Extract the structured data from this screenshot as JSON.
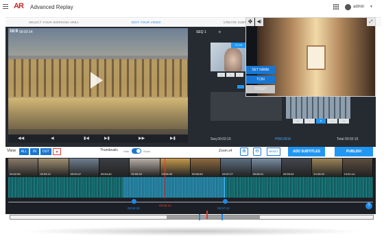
{
  "app": {
    "logo": "AR",
    "title": "Advanced Replay"
  },
  "user": {
    "name": "admin"
  },
  "steps": [
    {
      "label": "SELECT YOUR WORKING AREA",
      "active": false
    },
    {
      "label": "EDIT YOUR VIDEO",
      "active": true
    },
    {
      "label": "CREATE SUBTI...",
      "active": false
    }
  ],
  "video": {
    "aspect": "16:9",
    "timecode": "00:03:14"
  },
  "panel": {
    "tab": "SEQ 1",
    "add_tab": "+",
    "thumb_tag": "TC IN",
    "seq_time": "Seq 00:02:15",
    "preview": "PREVIEW",
    "total_time": "Total 00:02:15"
  },
  "overlay_menu": [
    {
      "label": "SET NAME"
    },
    {
      "label": "TCIN"
    },
    {
      "label": "TCOUT"
    }
  ],
  "toolbar": {
    "view_label": "View",
    "view_buttons": [
      "ALL",
      "IN",
      "OUT",
      "▼"
    ],
    "thumbnails_label": "Thumbnails",
    "hide": "Hide",
    "show": "Show",
    "zoom_label": "Zoom x4",
    "reset": "RESET",
    "add_subtitles": "ADD SUBTITLES",
    "publish": "PUBLISH"
  },
  "film_frames": [
    {
      "tc": "09:52:08",
      "color": "#8a7a6a"
    },
    {
      "tc": "09:53:12",
      "color": "#a19070"
    },
    {
      "tc": "09:53:47",
      "color": "#6f7f8f"
    },
    {
      "tc": "09:54:40",
      "color": "#3c3f44"
    },
    {
      "tc": "09:55:28",
      "color": "#b9b0a8"
    },
    {
      "tc": "09:56:09",
      "color": "#c49a4c"
    },
    {
      "tc": "09:56:53",
      "color": "#8e6a3e"
    },
    {
      "tc": "09:57:27",
      "color": "#5c6f80"
    },
    {
      "tc": "09:58:21",
      "color": "#7a8ea3"
    },
    {
      "tc": "09:59:02",
      "color": "#44484f"
    },
    {
      "tc": "10:00:03",
      "color": "#9c8458"
    },
    {
      "tc": "10:01:14",
      "color": "#5d4f40"
    }
  ],
  "timeline": {
    "tc_in": "09:55:28",
    "tc_current": "09:56:13",
    "tc_out": "09:57:43"
  },
  "help": "?"
}
